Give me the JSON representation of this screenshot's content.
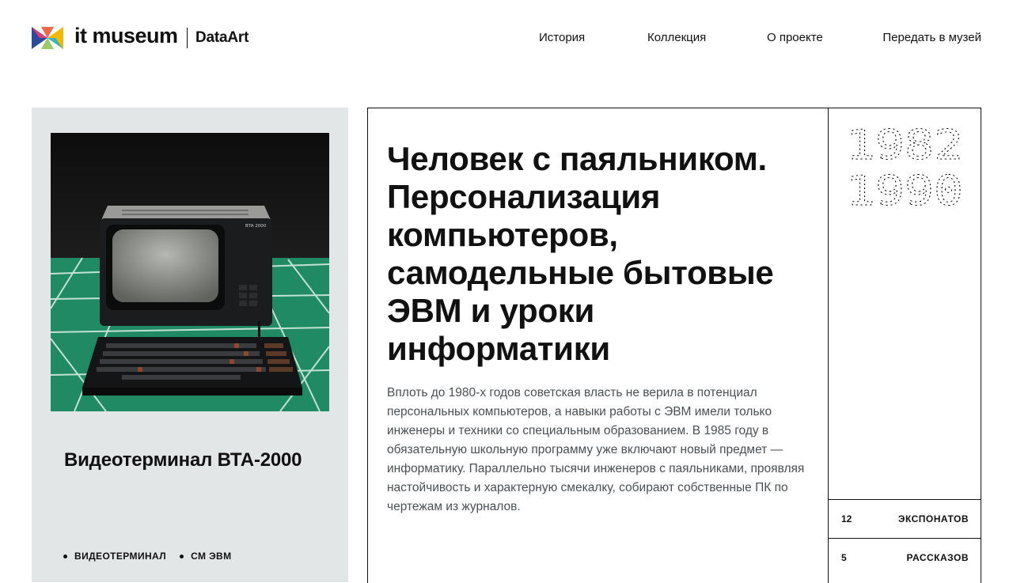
{
  "header": {
    "logo_text": "it museum",
    "logo_partner": "DataArt",
    "logo_icon": "it-museum-logo-mark",
    "nav": [
      {
        "label": "История"
      },
      {
        "label": "Коллекция"
      },
      {
        "label": "О проекте"
      },
      {
        "label": "Передать в музей"
      }
    ]
  },
  "exhibit": {
    "title": "Видеотерминал ВТА-2000",
    "photo_caption": "BTA 2000",
    "tags": [
      "ВИДЕОТЕРМИНАЛ",
      "СМ ЭВМ"
    ],
    "background_color": "#e3e6e6"
  },
  "article": {
    "headline": "Человек с паяльником. Персонализация компьютеров, самодельные бытовые ЭВМ и уроки информатики",
    "lead": "Вплоть до 1980-х годов советская власть не верила в потенциал персональных компьютеров, а навыки работы с ЭВМ имели только инженеры и техники со специальным образованием. В 1985 году в обязательную школьную программу уже включают новый предмет — информатику. Параллельно тысячи инженеров с паяльниками, проявляя настойчивость и характерную смекалку, собирают собственные ПК по чертежам из журналов.",
    "years": [
      "1982",
      "1990"
    ],
    "stats": [
      {
        "count": "12",
        "label": "ЭКСПОНАТОВ"
      },
      {
        "count": "5",
        "label": "РАССКАЗОВ"
      }
    ]
  },
  "colors": {
    "text": "#111111",
    "lead_text": "#4b4f52",
    "card_bg": "#e3e6e6",
    "floor_green": "#1f8a63"
  }
}
